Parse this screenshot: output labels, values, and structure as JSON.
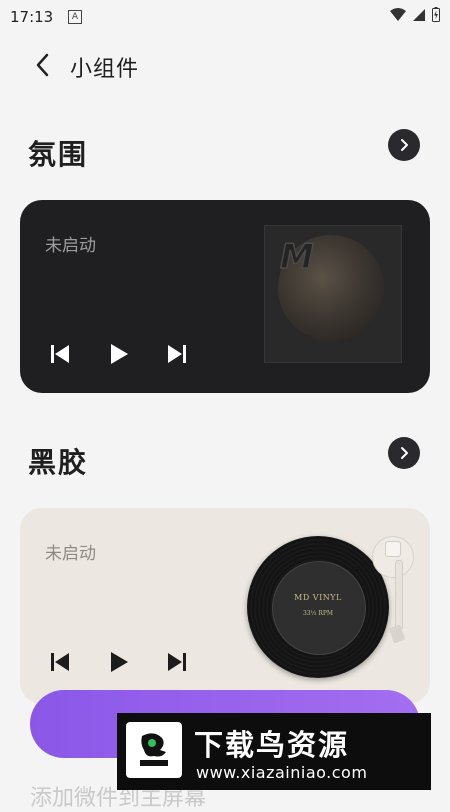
{
  "status_bar": {
    "time": "17:13",
    "notification_badge": "A"
  },
  "header": {
    "title": "小组件"
  },
  "sections": [
    {
      "title": "氛围",
      "card": {
        "status": "未启动",
        "art_letter": "M"
      }
    },
    {
      "title": "黑胶",
      "card": {
        "status": "未启动",
        "record_title": "MD VINYL",
        "record_sub": "33⅓ RPM"
      }
    }
  ],
  "bottom_hint": "添加微件到主屏幕",
  "watermark": {
    "title": "下载鸟资源",
    "url": "www.xiazainiao.com"
  },
  "colors": {
    "accent": "#9763ec",
    "dark_card": "#1f1f21",
    "light_card": "#ece8e1"
  }
}
